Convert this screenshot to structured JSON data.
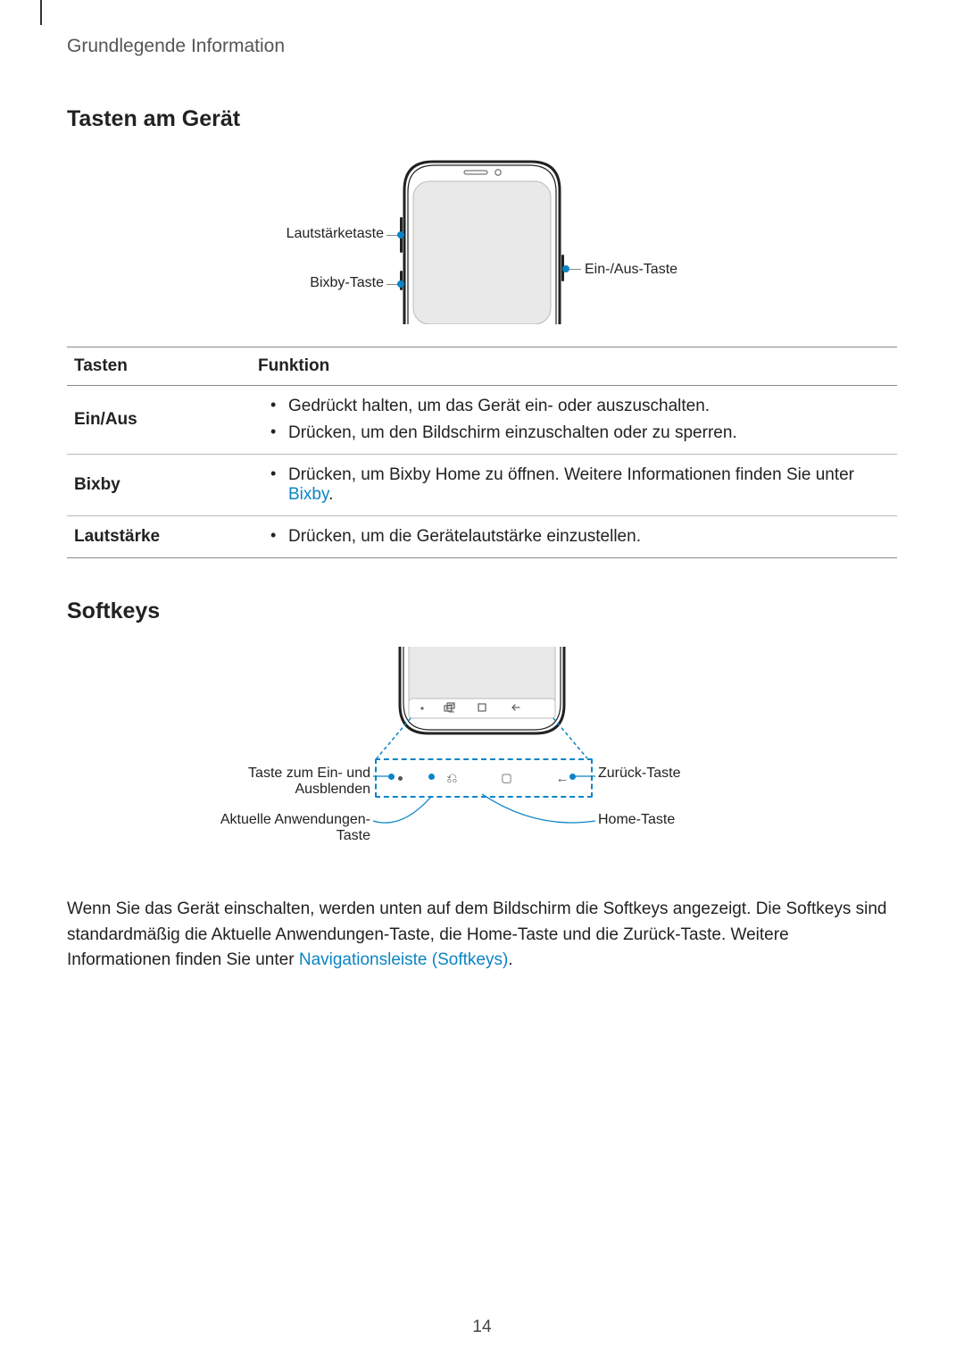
{
  "running_head": "Grundlegende Information",
  "section1": "Tasten am Gerät",
  "fig1": {
    "volume": "Lautstärketaste",
    "bixby": "Bixby-Taste",
    "power": "Ein-/Aus-Taste"
  },
  "table": {
    "head_key": "Tasten",
    "head_func": "Funktion",
    "rows": [
      {
        "key": "Ein/Aus",
        "items": [
          "Gedrückt halten, um das Gerät ein- oder auszuschalten.",
          "Drücken, um den Bildschirm einzuschalten oder zu sperren."
        ]
      },
      {
        "key": "Bixby",
        "items_pre": "Drücken, um Bixby Home zu öffnen. Weitere Informationen finden Sie unter ",
        "items_link": "Bixby",
        "items_post": "."
      },
      {
        "key": "Lautstärke",
        "items": [
          "Drücken, um die Gerätelautstärke einzustellen."
        ]
      }
    ]
  },
  "section2": "Softkeys",
  "fig2": {
    "hide": "Taste zum Ein- und Ausblenden",
    "recents": "Aktuelle Anwendungen-Taste",
    "back": "Zurück-Taste",
    "home": "Home-Taste"
  },
  "para": {
    "t1": "Wenn Sie das Gerät einschalten, werden unten auf dem Bildschirm die Softkeys angezeigt. Die Softkeys sind standardmäßig die Aktuelle Anwendungen-Taste, die Home-Taste und die Zurück-Taste. Weitere Informationen finden Sie unter ",
    "link": "Navigationsleiste (Softkeys)",
    "t2": "."
  },
  "page_number": "14"
}
